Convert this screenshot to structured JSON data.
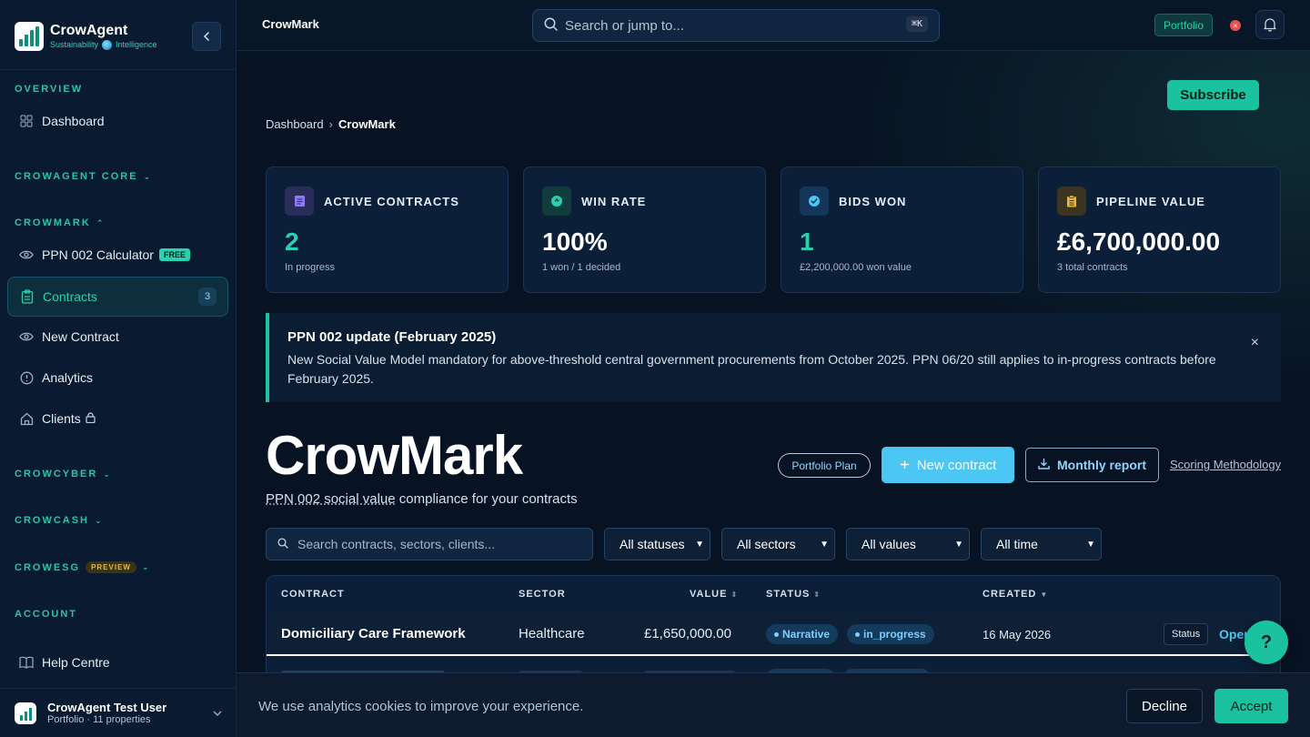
{
  "sidebar": {
    "brand_name": "CrowAgent",
    "brand_tag_left": "Sustainability",
    "brand_tag_right": "Intelligence",
    "sections": {
      "overview": "OVERVIEW",
      "core": "CROWAGENT CORE",
      "crowmark": "CROWMARK",
      "crowcyber": "CROWCYBER",
      "crowcash": "CROWCASH",
      "crowesg": "CROWESG",
      "crowesg_badge": "PREVIEW",
      "account": "ACCOUNT"
    },
    "items": {
      "dashboard": "Dashboard",
      "ppn": "PPN 002 Calculator",
      "ppn_badge": "FREE",
      "contracts": "Contracts",
      "contracts_count": "3",
      "new_contract": "New Contract",
      "analytics": "Analytics",
      "clients": "Clients",
      "help": "Help Centre"
    },
    "user": {
      "name": "CrowAgent Test User",
      "sub": "Portfolio · 11 properties"
    }
  },
  "topbar": {
    "title": "CrowMark",
    "search_placeholder": "Search or jump to...",
    "shortcut": "⌘K",
    "plan_pill": "Portfolio",
    "red_dot": "×"
  },
  "main": {
    "subscribe": "Subscribe",
    "breadcrumb": {
      "root": "Dashboard",
      "sep": "›",
      "current": "CrowMark"
    },
    "kpis": [
      {
        "label": "ACTIVE CONTRACTS",
        "value": "2",
        "sub": "In progress",
        "color": "#8b7cf6"
      },
      {
        "label": "WIN RATE",
        "value": "100%",
        "sub": "1 won / 1 decided",
        "color": "#2ad1b0"
      },
      {
        "label": "BIDS WON",
        "value": "1",
        "sub": "£2,200,000.00 won value",
        "color": "#4cc6f2"
      },
      {
        "label": "PIPELINE VALUE",
        "value": "£6,700,000.00",
        "sub": "3 total contracts",
        "color": "#e7b845"
      }
    ],
    "notice": {
      "title": "PPN 002 update (February 2025)",
      "body": "New Social Value Model mandatory for above-threshold central government procurements from October 2025. PPN 06/20 still applies to in-progress contracts before February 2025.",
      "close": "×"
    },
    "title": "CrowMark",
    "subtitle_link": "PPN 002 social value",
    "subtitle_rest": " compliance for your contracts",
    "plan_pill": "Portfolio Plan",
    "new_contract": "New contract",
    "monthly_report": "Monthly report",
    "methodology": "Scoring Methodology",
    "filters": {
      "search_placeholder": "Search contracts, sectors, clients...",
      "status": "All statuses",
      "sector": "All sectors",
      "value": "All values",
      "time": "All time"
    },
    "table": {
      "headers": {
        "contract": "CONTRACT",
        "sector": "SECTOR",
        "value": "VALUE",
        "status": "STATUS",
        "created": "CREATED"
      },
      "rows": [
        {
          "name": "Domiciliary Care Framework",
          "sector": "Healthcare",
          "value": "£1,650,000.00",
          "tag1": "Narrative",
          "tag2": "in_progress",
          "created": "16 May 2026",
          "status_btn": "Status",
          "open": "Open"
        }
      ]
    },
    "help_fab": "?"
  },
  "cookie": {
    "text": "We use analytics cookies to improve your experience.",
    "decline": "Decline",
    "accept": "Accept"
  }
}
